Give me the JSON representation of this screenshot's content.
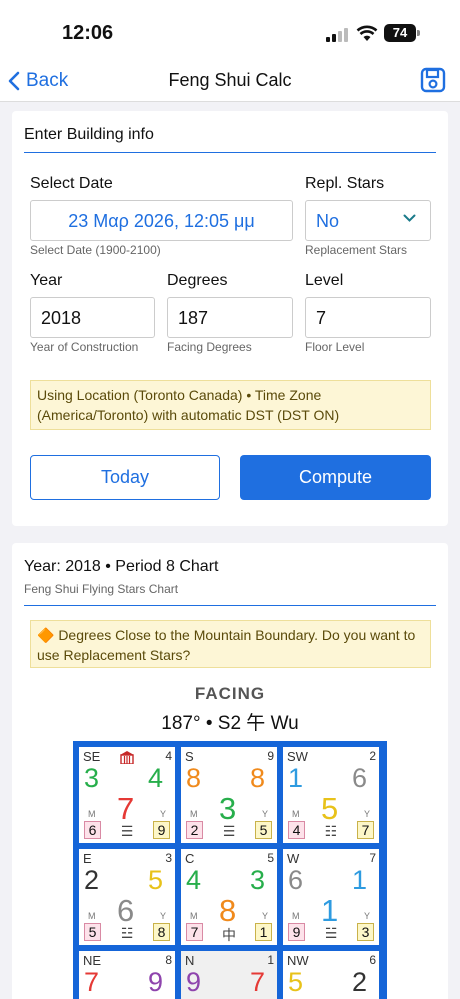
{
  "status_bar": {
    "time": "12:06",
    "battery": "74"
  },
  "nav": {
    "back_label": "Back",
    "title": "Feng Shui Calc"
  },
  "building_card": {
    "heading": "Enter Building info",
    "select_date": {
      "label": "Select Date",
      "value": "23 Μαρ 2026, 12:05 μμ",
      "hint": "Select Date (1900-2100)"
    },
    "repl_stars": {
      "label": "Repl. Stars",
      "value": "No",
      "hint": "Replacement Stars"
    },
    "year": {
      "label": "Year",
      "value": "2018",
      "hint": "Year of Construction"
    },
    "degrees": {
      "label": "Degrees",
      "value": "187",
      "hint": "Facing Degrees"
    },
    "level": {
      "label": "Level",
      "value": "7",
      "hint": "Floor Level"
    },
    "location_notice": "Using Location (Toronto Canada) • Time Zone (America/Toronto) with automatic DST (DST ON)",
    "today_button": "Today",
    "compute_button": "Compute"
  },
  "chart_card": {
    "heading": "Year: 2018 • Period 8 Chart",
    "subheading": "Feng Shui Flying Stars Chart",
    "warning": "🔶 Degrees Close to the Mountain Boundary. Do you want to use Replacement Stars?",
    "facing_label": "FACING",
    "facing_value": "187° • S2 午 Wu",
    "cells": [
      {
        "dir": "SE",
        "num": "4",
        "m": "3",
        "mc": "#27ae4b",
        "f": "4",
        "fc": "#27ae4b",
        "b": "7",
        "bc": "#e53935",
        "ml": "M",
        "yl": "Y",
        "lb": "6",
        "rb": "9",
        "tri": "☰",
        "home": true
      },
      {
        "dir": "S",
        "num": "9",
        "m": "8",
        "mc": "#f08a1c",
        "f": "8",
        "fc": "#f08a1c",
        "b": "3",
        "bc": "#27ae4b",
        "ml": "M",
        "yl": "Y",
        "lb": "2",
        "rb": "5",
        "tri": "☰",
        "home": false
      },
      {
        "dir": "SW",
        "num": "2",
        "m": "1",
        "mc": "#2e9be0",
        "f": "6",
        "fc": "#8a8a8a",
        "b": "5",
        "bc": "#e8c21a",
        "ml": "M",
        "yl": "Y",
        "lb": "4",
        "rb": "7",
        "tri": "☷",
        "home": false
      },
      {
        "dir": "E",
        "num": "3",
        "m": "2",
        "mc": "#333333",
        "f": "5",
        "fc": "#e8c21a",
        "b": "6",
        "bc": "#8a8a8a",
        "ml": "M",
        "yl": "Y",
        "lb": "5",
        "rb": "8",
        "tri": "☳",
        "home": false
      },
      {
        "dir": "C",
        "num": "5",
        "m": "4",
        "mc": "#27ae4b",
        "f": "3",
        "fc": "#27ae4b",
        "b": "8",
        "bc": "#f08a1c",
        "ml": "M",
        "yl": "Y",
        "lb": "7",
        "rb": "1",
        "tri": "中",
        "home": false
      },
      {
        "dir": "W",
        "num": "7",
        "m": "6",
        "mc": "#8a8a8a",
        "f": "1",
        "fc": "#2e9be0",
        "b": "1",
        "bc": "#2e9be0",
        "ml": "M",
        "yl": "Y",
        "lb": "9",
        "rb": "3",
        "tri": "☱",
        "home": false
      },
      {
        "dir": "NE",
        "num": "8",
        "m": "7",
        "mc": "#e53935",
        "f": "9",
        "fc": "#8e44ad",
        "b": "",
        "bc": "#333333",
        "ml": "",
        "yl": "",
        "lb": "",
        "rb": "",
        "tri": "",
        "home": false
      },
      {
        "dir": "N",
        "num": "1",
        "m": "9",
        "mc": "#8e44ad",
        "f": "7",
        "fc": "#e53935",
        "b": "",
        "bc": "#333333",
        "ml": "",
        "yl": "",
        "lb": "",
        "rb": "",
        "tri": "",
        "home": false
      },
      {
        "dir": "NW",
        "num": "6",
        "m": "5",
        "mc": "#e8c21a",
        "f": "2",
        "fc": "#333333",
        "b": "",
        "bc": "#333333",
        "ml": "",
        "yl": "",
        "lb": "",
        "rb": "",
        "tri": "",
        "home": false
      }
    ]
  },
  "colors": {
    "accent": "#1f6fe0",
    "grid_border": "#1565d8"
  }
}
